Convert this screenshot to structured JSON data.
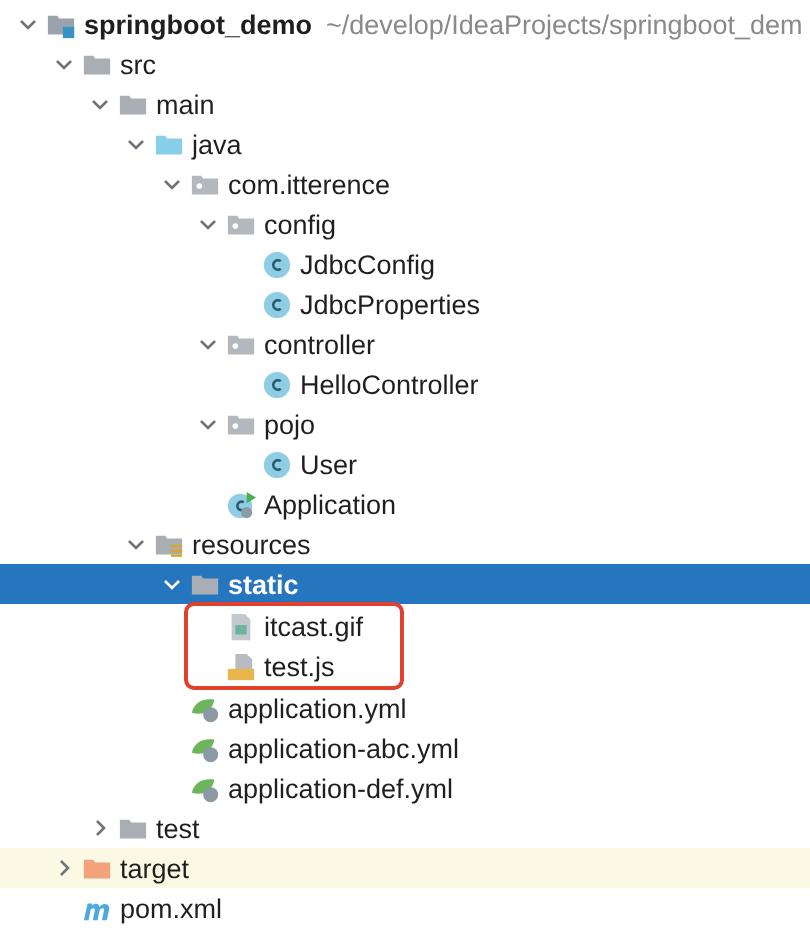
{
  "project_tree": [
    {
      "kind": "module",
      "label": "springboot_demo",
      "hint": "~/develop/IdeaProjects/springboot_dem",
      "expanded": true,
      "selected": false,
      "children": [
        {
          "kind": "folder",
          "label": "src",
          "expanded": true,
          "selected": false,
          "children": [
            {
              "kind": "folder",
              "label": "main",
              "expanded": true,
              "selected": false,
              "children": [
                {
                  "kind": "source-folder",
                  "label": "java",
                  "expanded": true,
                  "selected": false,
                  "children": [
                    {
                      "kind": "package",
                      "label": "com.itterence",
                      "expanded": true,
                      "selected": false,
                      "children": [
                        {
                          "kind": "package",
                          "label": "config",
                          "expanded": true,
                          "selected": false,
                          "children": [
                            {
                              "kind": "class",
                              "label": "JdbcConfig",
                              "selected": false
                            },
                            {
                              "kind": "class",
                              "label": "JdbcProperties",
                              "selected": false
                            }
                          ]
                        },
                        {
                          "kind": "package",
                          "label": "controller",
                          "expanded": true,
                          "selected": false,
                          "children": [
                            {
                              "kind": "class",
                              "label": "HelloController",
                              "selected": false
                            }
                          ]
                        },
                        {
                          "kind": "package",
                          "label": "pojo",
                          "expanded": true,
                          "selected": false,
                          "children": [
                            {
                              "kind": "class",
                              "label": "User",
                              "selected": false
                            }
                          ]
                        },
                        {
                          "kind": "app-class",
                          "label": "Application",
                          "selected": false
                        }
                      ]
                    }
                  ]
                },
                {
                  "kind": "resources",
                  "label": "resources",
                  "expanded": true,
                  "selected": false,
                  "children": [
                    {
                      "kind": "folder",
                      "label": "static",
                      "expanded": true,
                      "selected": true,
                      "children": [
                        {
                          "kind": "image-file",
                          "label": "itcast.gif",
                          "selected": false,
                          "marked": true
                        },
                        {
                          "kind": "js-file",
                          "label": "test.js",
                          "selected": false,
                          "marked": true
                        }
                      ]
                    },
                    {
                      "kind": "spring-yml",
                      "label": "application.yml",
                      "selected": false
                    },
                    {
                      "kind": "spring-yml",
                      "label": "application-abc.yml",
                      "selected": false
                    },
                    {
                      "kind": "spring-yml",
                      "label": "application-def.yml",
                      "selected": false
                    }
                  ]
                }
              ]
            },
            {
              "kind": "folder",
              "label": "test",
              "expanded": false,
              "selected": false
            }
          ]
        },
        {
          "kind": "excluded-folder",
          "label": "target",
          "expanded": false,
          "selected": false
        },
        {
          "kind": "maven",
          "label": "pom.xml",
          "selected": false
        }
      ]
    }
  ]
}
